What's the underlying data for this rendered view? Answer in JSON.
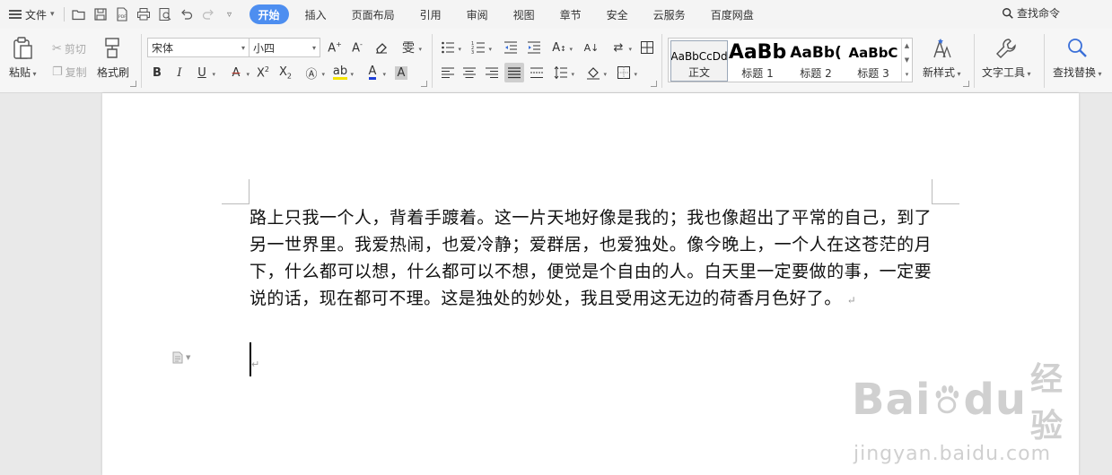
{
  "menubar": {
    "file_label": "文件",
    "tabs": [
      {
        "label": "开始",
        "active": true
      },
      {
        "label": "插入",
        "active": false
      },
      {
        "label": "页面布局",
        "active": false
      },
      {
        "label": "引用",
        "active": false
      },
      {
        "label": "审阅",
        "active": false
      },
      {
        "label": "视图",
        "active": false
      },
      {
        "label": "章节",
        "active": false
      },
      {
        "label": "安全",
        "active": false
      },
      {
        "label": "云服务",
        "active": false
      },
      {
        "label": "百度网盘",
        "active": false
      }
    ],
    "search_command": "查找命令",
    "accent_color": "#4d8ef0"
  },
  "ribbon": {
    "clipboard": {
      "paste": "粘贴",
      "cut": "剪切",
      "copy": "复制",
      "format_painter": "格式刷"
    },
    "font": {
      "font_name": "宋体",
      "font_size": "小四"
    },
    "styles": [
      {
        "preview": "AaBbCcDd",
        "name": "正文",
        "selected": true
      },
      {
        "preview": "AaBb",
        "name": "标题 1",
        "selected": false
      },
      {
        "preview": "AaBb(",
        "name": "标题 2",
        "selected": false
      },
      {
        "preview": "AaBbC",
        "name": "标题 3",
        "selected": false
      }
    ],
    "new_style": "新样式",
    "text_tools": "文字工具",
    "find_replace": "查找替换"
  },
  "document": {
    "paragraph": "路上只我一个人，背着手踱着。这一片天地好像是我的；我也像超出了平常的自己，到了另一世界里。我爱热闹，也爱冷静；爱群居，也爱独处。像今晚上，一个人在这苍茫的月下，什么都可以想，什么都可以不想，便觉是个自由的人。白天里一定要做的事，一定要说的话，现在都可不理。这是独处的妙处，我且受用这无边的荷香月色好了。",
    "paragraph_mark": "↵"
  },
  "watermark": {
    "main": "Bai",
    "mid": "du",
    "cn": "经验",
    "sub": "jingyan.baidu.com"
  }
}
